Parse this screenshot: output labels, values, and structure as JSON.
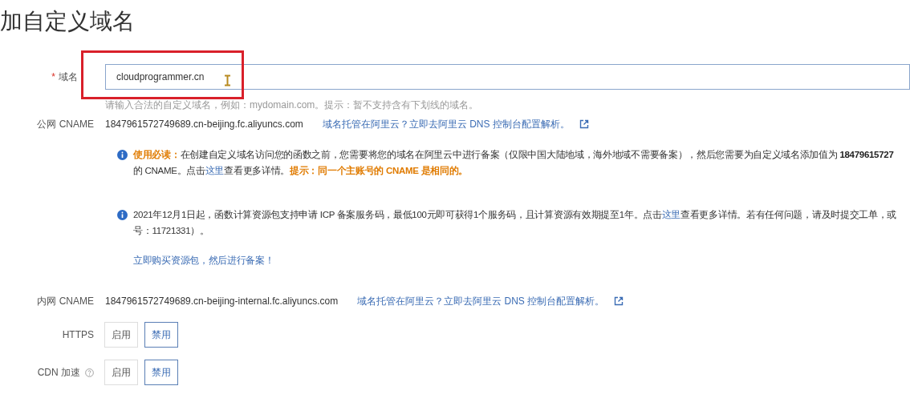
{
  "title": "加自定义域名",
  "domain_field": {
    "label": "域名",
    "required_mark": "*",
    "value": "cloudprogrammer.cn",
    "hint": "请输入合法的自定义域名，例如：mydomain.com。提示：暂不支持含有下划线的域名。"
  },
  "public_cname": {
    "label": "公网 CNAME",
    "value": "1847961572749689.cn-beijing.fc.aliyuncs.com",
    "link": "域名托管在阿里云？立即去阿里云 DNS 控制台配置解析。"
  },
  "notices": [
    {
      "lines": [
        [
          {
            "kind": "text",
            "text": "**使用必读：**在创建自定义域名访问您的函数之前，您需要将您的域名在阿里云中进行备案（仅限中国大陆地域，海外地域不需要备案），然后您需要为自定义域名添加值为 **18479615727**"
          }
        ],
        [
          {
            "kind": "text",
            "text": "的 CNAME。点击"
          },
          {
            "kind": "link",
            "text": "这里"
          },
          {
            "kind": "text",
            "text": "查看更多详情。**提示：同一个主账号的 CNAME 是相同的。**"
          }
        ]
      ]
    },
    {
      "lines": [
        [
          {
            "kind": "text",
            "text": "2021年12月1日起，函数计算资源包支持申请 ICP 备案服务码，最低100元即可获得1个服务码，且计算资源有效期提至1年。点击"
          },
          {
            "kind": "link",
            "text": "这里"
          },
          {
            "kind": "text",
            "text": "查看更多详情。若有任何问题，请及时提交工单，或"
          }
        ],
        [
          {
            "kind": "text",
            "text": "号：11721331）。"
          }
        ]
      ],
      "action": "立即购买资源包，然后进行备案！"
    }
  ],
  "internal_cname": {
    "label": "内网 CNAME",
    "value": "1847961572749689.cn-beijing-internal.fc.aliyuncs.com",
    "link": "域名托管在阿里云？立即去阿里云 DNS 控制台配置解析。"
  },
  "toggles": [
    {
      "label": "HTTPS",
      "help": false,
      "options": [
        {
          "label": "启用",
          "selected": false
        },
        {
          "label": "禁用",
          "selected": true
        }
      ]
    },
    {
      "label": "CDN 加速",
      "help": true,
      "options": [
        {
          "label": "启用",
          "selected": false
        },
        {
          "label": "禁用",
          "selected": true
        }
      ]
    }
  ]
}
